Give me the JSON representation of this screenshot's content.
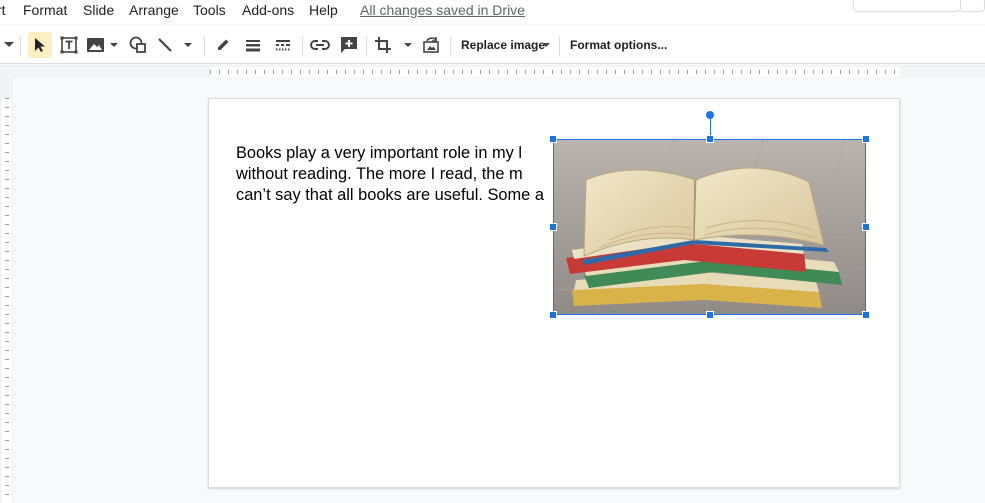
{
  "menu": {
    "items": [
      "rt",
      "Format",
      "Slide",
      "Arrange",
      "Tools",
      "Add-ons",
      "Help"
    ],
    "save_status": "All changes saved in Drive"
  },
  "toolbar": {
    "replace_image": "Replace image",
    "format_options": "Format options...",
    "icons": [
      "select-icon",
      "text-box-icon",
      "image-icon",
      "shape-icon",
      "line-icon",
      "pen-color-icon",
      "border-weight-icon",
      "border-dash-icon",
      "link-icon",
      "comment-icon",
      "crop-icon",
      "reset-image-icon"
    ],
    "selected_color": "#feefc3"
  },
  "slide": {
    "text_lines": [
      "Books play a very important role in my l",
      "without reading. The more I read, the m",
      "can’t say that all books are useful. Some a"
    ]
  },
  "colors": {
    "accent": "#1a73e8"
  }
}
